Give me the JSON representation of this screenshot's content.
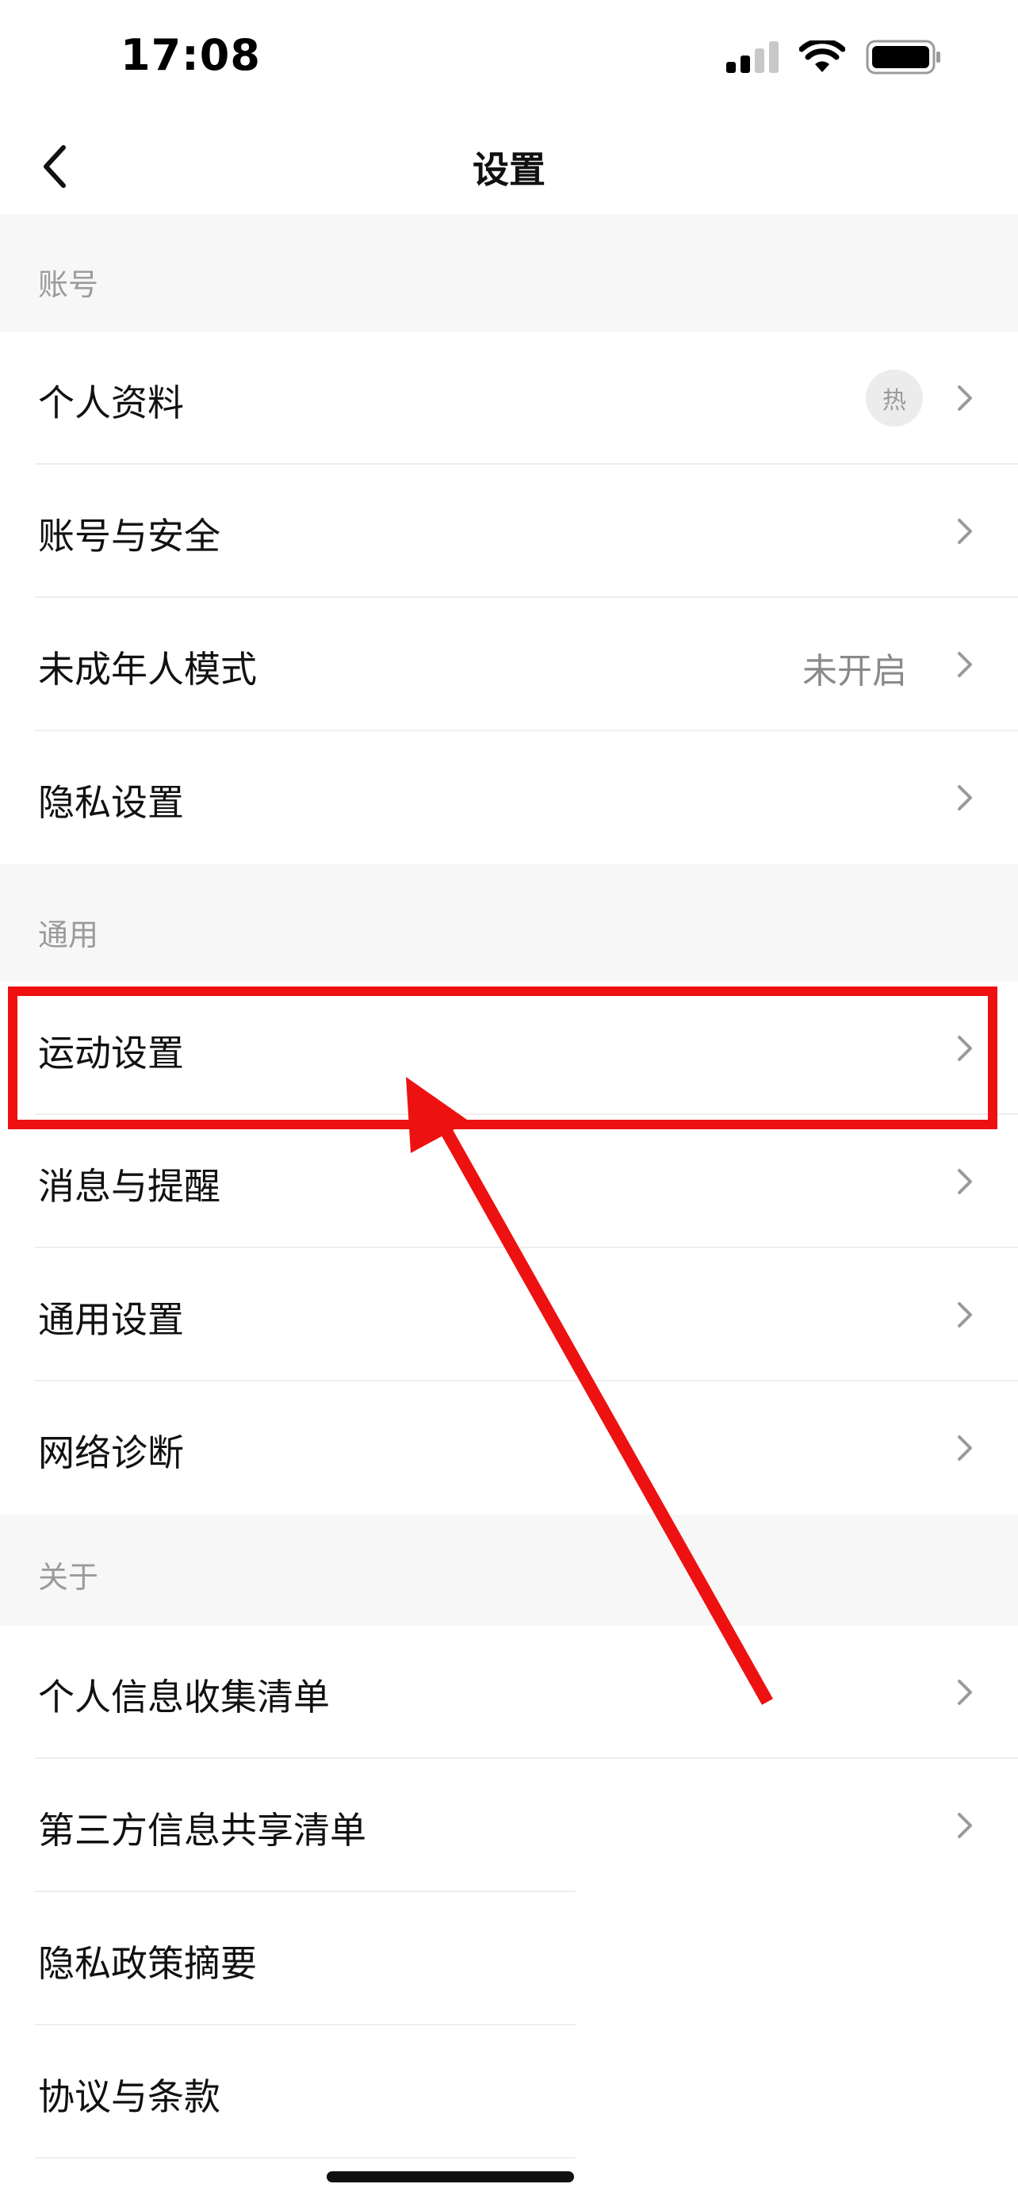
{
  "status_bar": {
    "time": "17:08"
  },
  "nav": {
    "title": "设置"
  },
  "sections": {
    "account": {
      "header": "账号",
      "items": [
        {
          "label": "个人资料",
          "badge": "热"
        },
        {
          "label": "账号与安全"
        },
        {
          "label": "未成年人模式",
          "value": "未开启"
        },
        {
          "label": "隐私设置"
        }
      ]
    },
    "general": {
      "header": "通用",
      "items": [
        {
          "label": "运动设置"
        },
        {
          "label": "消息与提醒"
        },
        {
          "label": "通用设置"
        },
        {
          "label": "网络诊断"
        }
      ]
    },
    "about": {
      "header": "关于",
      "items": [
        {
          "label": "个人信息收集清单"
        },
        {
          "label": "第三方信息共享清单"
        },
        {
          "label": "隐私政策摘要"
        },
        {
          "label": "协议与条款"
        }
      ]
    }
  },
  "colors": {
    "annotation": "#ee1111",
    "section_bg": "#f7f7f7",
    "secondary_text": "#8a8a8a"
  },
  "icons": {
    "back": "chevron-left-icon",
    "row": "chevron-right-icon",
    "signal": "cellular-signal-icon",
    "wifi": "wifi-icon",
    "battery": "battery-icon"
  }
}
